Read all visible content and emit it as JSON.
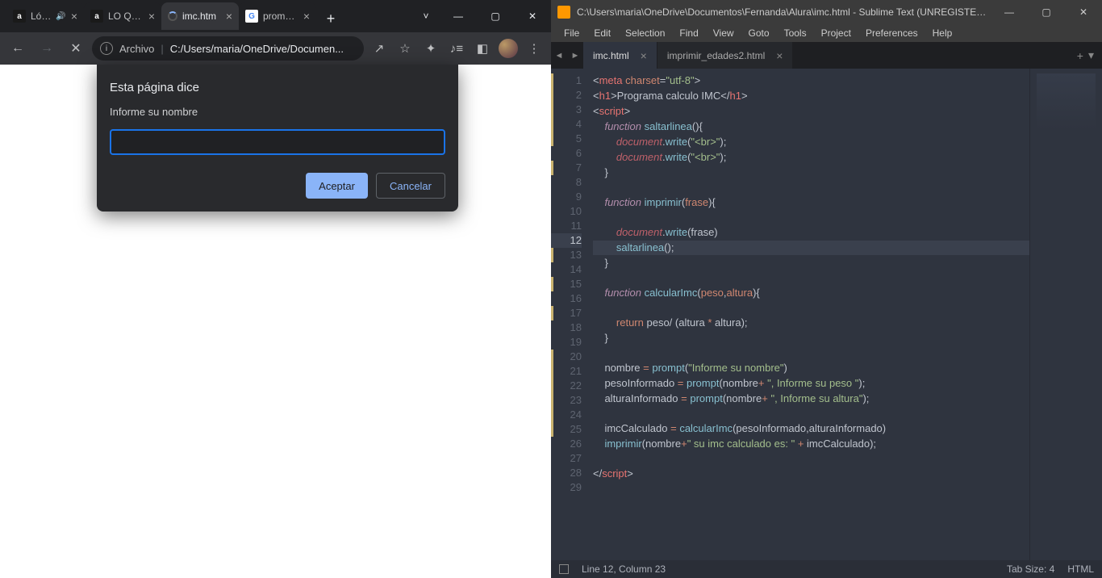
{
  "browser": {
    "tabs": [
      {
        "title": "Ló…",
        "audio": true,
        "favicon_letter": "a",
        "favicon_bg": "#1a1a1a"
      },
      {
        "title": "LO QU…",
        "favicon_letter": "a",
        "favicon_bg": "#1a1a1a"
      },
      {
        "title": "imc.htm",
        "favicon_spinner": true,
        "active": true
      },
      {
        "title": "promp…",
        "favicon_letter": "G",
        "favicon_bg": "#ffffff",
        "favicon_color": "#4285F4"
      }
    ],
    "new_tab": "+",
    "window_controls": {
      "dropdown": "˅",
      "minimize": "—",
      "maximize": "▢",
      "close": "✕"
    },
    "nav": {
      "back": "←",
      "forward": "→",
      "reload": "✕"
    },
    "address": {
      "info": "i",
      "file_label": "Archivo",
      "sep": "|",
      "url": "C:/Users/maria/OneDrive/Documen..."
    },
    "right_icons": {
      "share": "↗",
      "star": "☆",
      "ext": "✦",
      "media": "♪≡",
      "panel": "◧",
      "menu": "⋮"
    },
    "dialog": {
      "title": "Esta página dice",
      "message": "Informe su nombre",
      "value": "",
      "ok": "Aceptar",
      "cancel": "Cancelar"
    }
  },
  "editor": {
    "title": "C:\\Users\\maria\\OneDrive\\Documentos\\Fernanda\\Alura\\imc.html - Sublime Text (UNREGISTERE...",
    "window_controls": {
      "minimize": "—",
      "maximize": "▢",
      "close": "✕"
    },
    "menus": [
      "File",
      "Edit",
      "Selection",
      "Find",
      "View",
      "Goto",
      "Tools",
      "Project",
      "Preferences",
      "Help"
    ],
    "tabs": [
      {
        "name": "imc.html",
        "active": true
      },
      {
        "name": "imprimir_edades2.html",
        "active": false
      }
    ],
    "tab_tools": {
      "nav_prev": "◄",
      "nav_next": "►",
      "add": "+",
      "dropdown": "▾"
    },
    "line_count": 29,
    "cursor_line": 12,
    "modified_ranges": [
      [
        1,
        5
      ],
      [
        7,
        7
      ],
      [
        13,
        13
      ],
      [
        15,
        15
      ],
      [
        17,
        17
      ],
      [
        20,
        25
      ]
    ],
    "status": {
      "pos": "Line 12, Column 23",
      "tab_size": "Tab Size: 4",
      "syntax": "HTML"
    },
    "code_lines": [
      [
        [
          "p",
          "<"
        ],
        [
          "t",
          "meta"
        ],
        [
          "p",
          " "
        ],
        [
          "a",
          "charset"
        ],
        [
          "p",
          "="
        ],
        [
          "s",
          "\"utf-8\""
        ],
        [
          "p",
          ">"
        ]
      ],
      [
        [
          "p",
          "<"
        ],
        [
          "t",
          "h1"
        ],
        [
          "p",
          ">Programa calculo IMC</"
        ],
        [
          "t",
          "h1"
        ],
        [
          "p",
          ">"
        ]
      ],
      [
        [
          "p",
          "<"
        ],
        [
          "t",
          "script"
        ],
        [
          "p",
          ">"
        ]
      ],
      [
        [
          "p",
          "    "
        ],
        [
          "ki",
          "function"
        ],
        [
          "p",
          " "
        ],
        [
          "f",
          "saltarlinea"
        ],
        [
          "p",
          "(){"
        ]
      ],
      [
        [
          "p",
          "        "
        ],
        [
          "vi",
          "document"
        ],
        [
          "p",
          "."
        ],
        [
          "f",
          "write"
        ],
        [
          "p",
          "("
        ],
        [
          "s",
          "\"<br>\""
        ],
        [
          "p",
          ");"
        ]
      ],
      [
        [
          "p",
          "        "
        ],
        [
          "vi",
          "document"
        ],
        [
          "p",
          "."
        ],
        [
          "f",
          "write"
        ],
        [
          "p",
          "("
        ],
        [
          "s",
          "\"<br>\""
        ],
        [
          "p",
          ");"
        ]
      ],
      [
        [
          "p",
          "    }"
        ]
      ],
      [],
      [
        [
          "p",
          "    "
        ],
        [
          "ki",
          "function"
        ],
        [
          "p",
          " "
        ],
        [
          "f",
          "imprimir"
        ],
        [
          "p",
          "("
        ],
        [
          "a",
          "frase"
        ],
        [
          "p",
          "){"
        ]
      ],
      [],
      [
        [
          "p",
          "        "
        ],
        [
          "vi",
          "document"
        ],
        [
          "p",
          "."
        ],
        [
          "f",
          "write"
        ],
        [
          "p",
          "(frase)"
        ]
      ],
      [
        [
          "p",
          "        "
        ],
        [
          "f",
          "saltarlinea"
        ],
        [
          "p",
          "();"
        ]
      ],
      [
        [
          "p",
          "    }"
        ]
      ],
      [],
      [
        [
          "p",
          "    "
        ],
        [
          "ki",
          "function"
        ],
        [
          "p",
          " "
        ],
        [
          "f",
          "calcularImc"
        ],
        [
          "p",
          "("
        ],
        [
          "a",
          "peso"
        ],
        [
          "p",
          ","
        ],
        [
          "a",
          "altura"
        ],
        [
          "p",
          "){"
        ]
      ],
      [],
      [
        [
          "p",
          "        "
        ],
        [
          "a",
          "return"
        ],
        [
          "p",
          " peso/ (altura "
        ],
        [
          "a",
          "*"
        ],
        [
          "p",
          " altura);"
        ]
      ],
      [
        [
          "p",
          "    }"
        ]
      ],
      [],
      [
        [
          "p",
          "    nombre "
        ],
        [
          "a",
          "="
        ],
        [
          "p",
          " "
        ],
        [
          "f",
          "prompt"
        ],
        [
          "p",
          "("
        ],
        [
          "s",
          "\"Informe su nombre\""
        ],
        [
          "p",
          ")"
        ]
      ],
      [
        [
          "p",
          "    pesoInformado "
        ],
        [
          "a",
          "="
        ],
        [
          "p",
          " "
        ],
        [
          "f",
          "prompt"
        ],
        [
          "p",
          "(nombre"
        ],
        [
          "a",
          "+"
        ],
        [
          "p",
          " "
        ],
        [
          "s",
          "\", Informe su peso \""
        ],
        [
          "p",
          ");"
        ]
      ],
      [
        [
          "p",
          "    alturaInformado "
        ],
        [
          "a",
          "="
        ],
        [
          "p",
          " "
        ],
        [
          "f",
          "prompt"
        ],
        [
          "p",
          "(nombre"
        ],
        [
          "a",
          "+"
        ],
        [
          "p",
          " "
        ],
        [
          "s",
          "\", Informe su altura\""
        ],
        [
          "p",
          ");"
        ]
      ],
      [],
      [
        [
          "p",
          "    imcCalculado "
        ],
        [
          "a",
          "="
        ],
        [
          "p",
          " "
        ],
        [
          "f",
          "calcularImc"
        ],
        [
          "p",
          "(pesoInformado,alturaInformado)"
        ]
      ],
      [
        [
          "p",
          "    "
        ],
        [
          "f",
          "imprimir"
        ],
        [
          "p",
          "(nombre"
        ],
        [
          "a",
          "+"
        ],
        [
          "s",
          "\" su imc calculado es: \""
        ],
        [
          "p",
          " "
        ],
        [
          "a",
          "+"
        ],
        [
          "p",
          " imcCalculado);"
        ]
      ],
      [],
      [
        [
          "p",
          "</"
        ],
        [
          "t",
          "script"
        ],
        [
          "p",
          ">"
        ]
      ],
      [],
      []
    ]
  }
}
